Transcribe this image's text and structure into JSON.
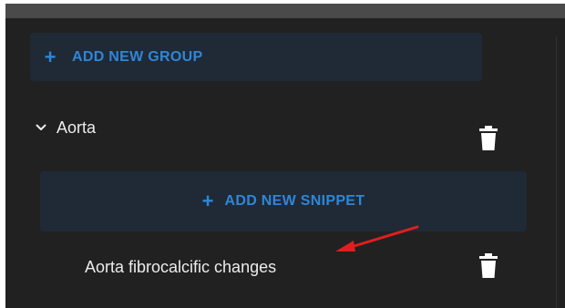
{
  "add_group": {
    "icon": "plus-icon",
    "label": "ADD NEW GROUP"
  },
  "group": {
    "name": "Aorta",
    "expand_icon": "chevron-down-icon",
    "delete_icon": "trash-icon",
    "add_snippet": {
      "icon": "plus-icon",
      "label": "ADD NEW SNIPPET"
    },
    "snippets": [
      {
        "name": "Aorta fibrocalcific changes",
        "delete_icon": "trash-icon"
      }
    ]
  },
  "annotation": {
    "icon": "red-arrow-icon"
  },
  "colors": {
    "accent": "#2f86d6",
    "panel_bg": "#212121",
    "button_bg": "#1f2a36",
    "text": "#ececec",
    "arrow": "#e01e1e"
  }
}
